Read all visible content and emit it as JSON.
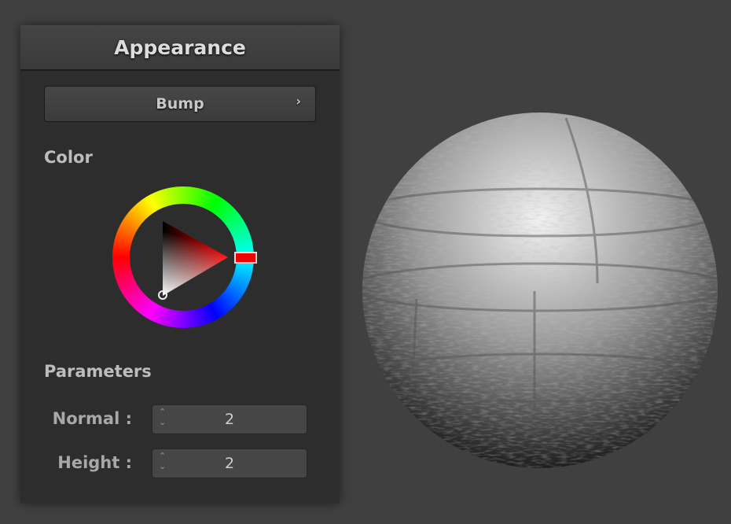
{
  "panel": {
    "title": "Appearance",
    "mode_button": "Bump",
    "color_label": "Color",
    "parameters_label": "Parameters"
  },
  "color": {
    "selected_hue": "#ff0000"
  },
  "parameters": [
    {
      "label": "Normal :",
      "value": "2"
    },
    {
      "label": "Height :",
      "value": "2"
    }
  ],
  "icons": {
    "chevron": "›",
    "spin_up": "⌃",
    "spin_down": "⌄"
  }
}
